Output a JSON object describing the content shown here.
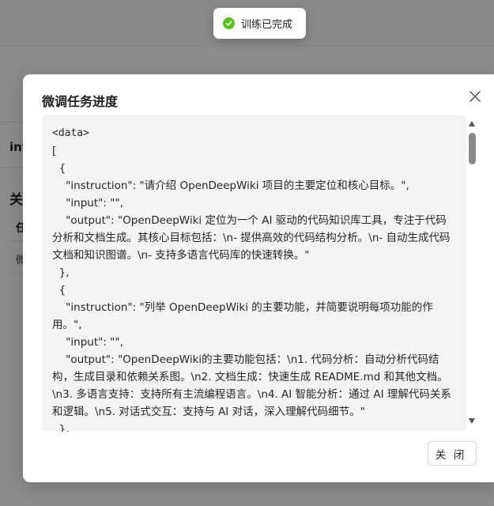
{
  "toast": {
    "icon": "check-circle-icon",
    "text": "训练已完成",
    "color": "#52c41a"
  },
  "background": {
    "tab_label": "int",
    "section_title": "关",
    "column_header": "任",
    "row_cell": "微"
  },
  "modal": {
    "title": "微调任务进度",
    "close_icon": "close-icon",
    "close_button_label": "关 闭",
    "content_lines": [
      "<data>",
      "[",
      "  {",
      "    \"instruction\": \"请介绍 OpenDeepWiki 项目的主要定位和核心目标。\",",
      "    \"input\": \"\",",
      "    \"output\": \"OpenDeepWiki 定位为一个 AI 驱动的代码知识库工具，专注于代码分析和文档生成。其核心目标包括：\\n- 提供高效的代码结构分析。\\n- 自动生成代码文档和知识图谱。\\n- 支持多语言代码库的快速转换。\"",
      "  },",
      "  {",
      "    \"instruction\": \"列举 OpenDeepWiki 的主要功能，并简要说明每项功能的作用。\",",
      "    \"input\": \"\",",
      "    \"output\": \"OpenDeepWiki的主要功能包括：\\n1. 代码分析：自动分析代码结构，生成目录和依赖关系图。\\n2. 文档生成：快速生成 README.md 和其他文档。\\n3. 多语言支持：支持所有主流编程语言。\\n4. AI 智能分析：通过 AI 理解代码关系和逻辑。\\n5. 对话式交互：支持与 AI 对话，深入理解代码细节。\"",
      "  },",
      "  {"
    ]
  }
}
